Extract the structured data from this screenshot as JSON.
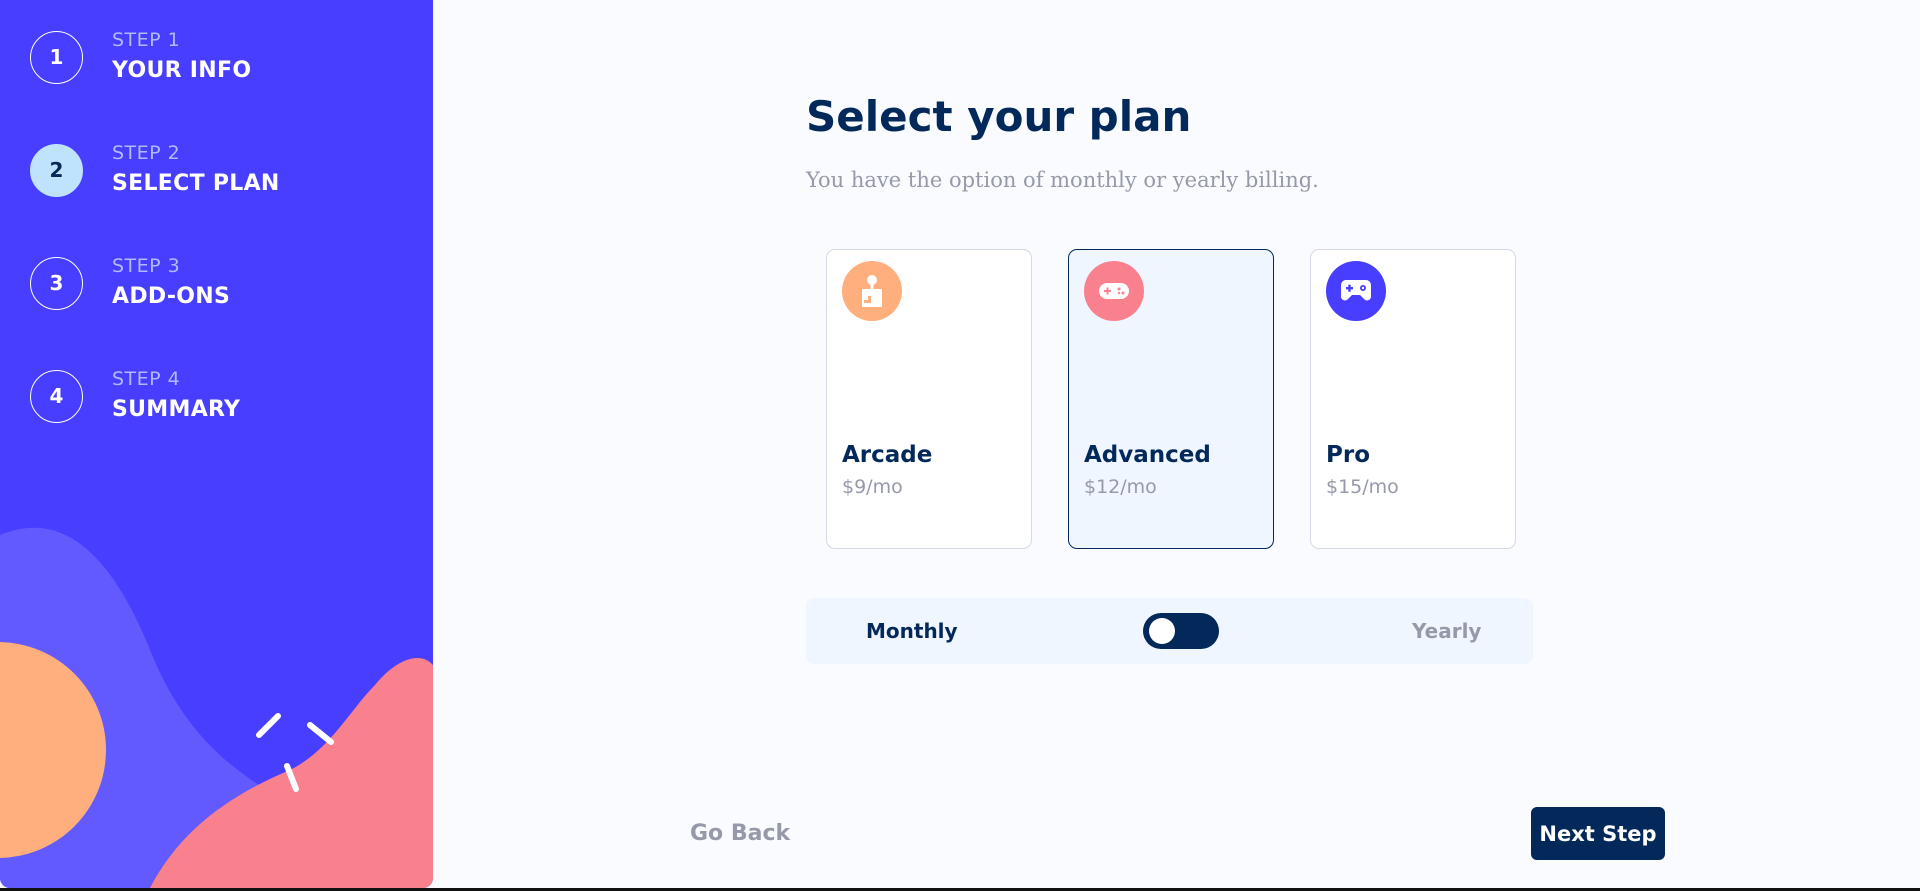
{
  "sidebar": {
    "steps": [
      {
        "number": "1",
        "label": "STEP 1",
        "title": "YOUR INFO",
        "active": false
      },
      {
        "number": "2",
        "label": "STEP 2",
        "title": "SELECT PLAN",
        "active": true
      },
      {
        "number": "3",
        "label": "STEP 3",
        "title": "ADD-ONS",
        "active": false
      },
      {
        "number": "4",
        "label": "STEP 4",
        "title": "SUMMARY",
        "active": false
      }
    ]
  },
  "main": {
    "title": "Select your plan",
    "subtitle": "You have the option of monthly or yearly billing."
  },
  "plans": [
    {
      "name": "Arcade",
      "price": "$9/mo",
      "icon": "arcade-icon",
      "color": "#ffaf7e",
      "selected": false
    },
    {
      "name": "Advanced",
      "price": "$12/mo",
      "icon": "advanced-icon",
      "color": "#f9818e",
      "selected": true
    },
    {
      "name": "Pro",
      "price": "$15/mo",
      "icon": "pro-icon",
      "color": "#483eff",
      "selected": false
    }
  ],
  "billing": {
    "monthly_label": "Monthly",
    "yearly_label": "Yearly",
    "selected": "Monthly"
  },
  "footer": {
    "back_label": "Go Back",
    "next_label": "Next Step"
  },
  "colors": {
    "sidebar": "#483eff",
    "primary": "#022959",
    "muted": "#9699aa",
    "active_step": "#bfe2fd"
  }
}
